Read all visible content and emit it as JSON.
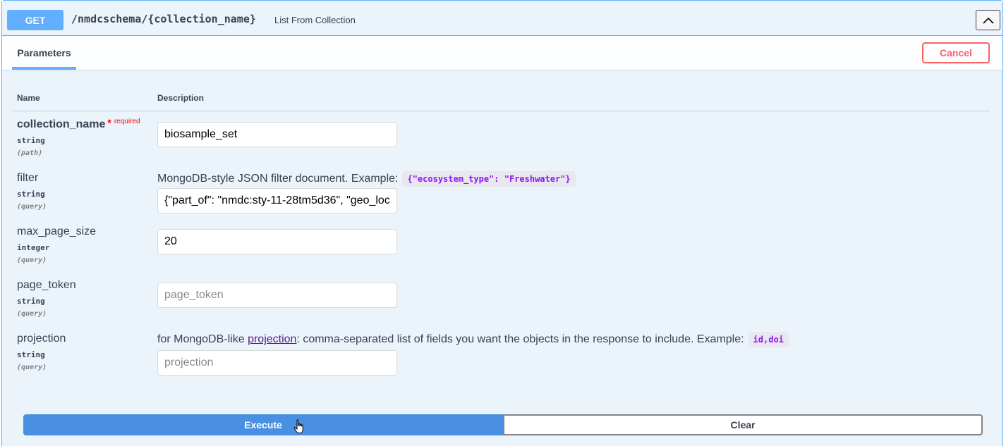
{
  "summary": {
    "method": "GET",
    "path": "/nmdcschema/{collection_name}",
    "description": "List From Collection"
  },
  "section": {
    "tab_label": "Parameters",
    "cancel_label": "Cancel"
  },
  "table_headers": {
    "name": "Name",
    "description": "Description"
  },
  "params": [
    {
      "name": "collection_name",
      "required_mark": "*",
      "required_label": "required",
      "type": "string",
      "in": "(path)",
      "value": "biosample_set",
      "placeholder": ""
    },
    {
      "name": "filter",
      "type": "string",
      "in": "(query)",
      "description": "MongoDB-style JSON filter document. Example:",
      "example": "{\"ecosystem_type\": \"Freshwater\"}",
      "value": "{\"part_of\": \"nmdc:sty-11-28tm5d36\", \"geo_loc",
      "placeholder": ""
    },
    {
      "name": "max_page_size",
      "type": "integer",
      "in": "(query)",
      "value": "20",
      "placeholder": ""
    },
    {
      "name": "page_token",
      "type": "string",
      "in": "(query)",
      "value": "",
      "placeholder": "page_token"
    },
    {
      "name": "projection",
      "type": "string",
      "in": "(query)",
      "description_prefix": "for MongoDB-like",
      "description_link": "projection",
      "description_suffix": ": comma-separated list of fields you want the objects in the response to include. Example:",
      "example": "id,doi",
      "value": "",
      "placeholder": "projection"
    }
  ],
  "actions": {
    "execute_label": "Execute",
    "clear_label": "Clear"
  },
  "colors": {
    "get_blue": "#61affe",
    "execute_blue": "#4990e2",
    "cancel_red": "#ff6060",
    "code_purple": "#9012fe"
  }
}
